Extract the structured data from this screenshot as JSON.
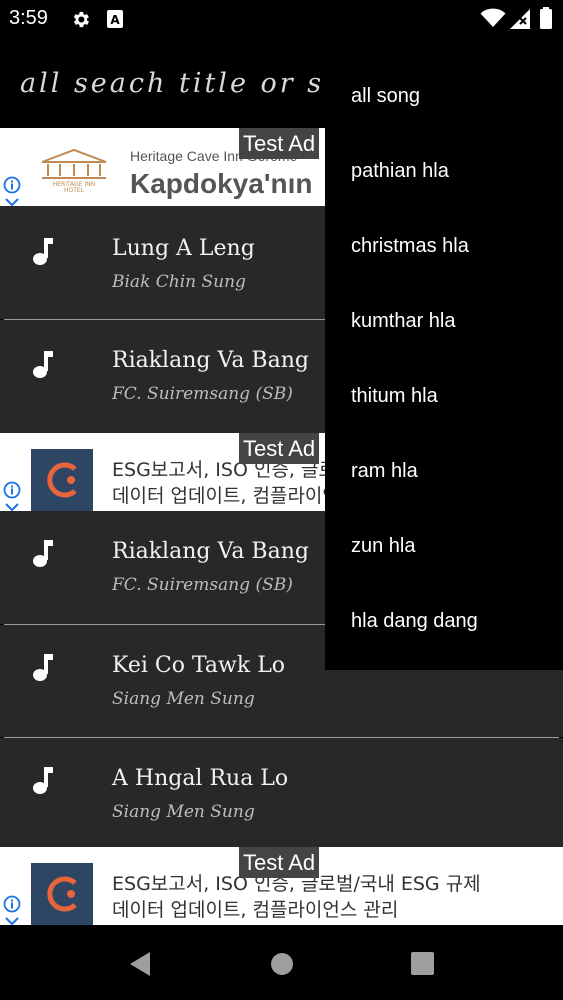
{
  "status_bar": {
    "time": "3:59",
    "icons": [
      "settings-icon",
      "a-icon",
      "wifi-icon",
      "signal-icon",
      "battery-icon"
    ]
  },
  "toolbar": {
    "search_title": "all seach title or sir"
  },
  "ads": [
    {
      "label": "Test Ad",
      "small_text": "Heritage Cave Inn Göreme",
      "big_text": "Kapdokya'nın",
      "logo": "hotel-logo"
    },
    {
      "label": "Test Ad",
      "line1": "ESG보고서, ISO 인증, 글로벌/국내 ESG 규제",
      "line2": "데이터 업데이트, 컴플라이언스 관리",
      "logo": "c-logo"
    },
    {
      "label": "Test Ad",
      "line1": "ESG보고서, ISO 인증, 글로벌/국내 ESG 규제",
      "line2": "데이터 업데이트, 컴플라이언스 관리",
      "logo": "c-logo"
    }
  ],
  "songs": [
    {
      "title": "Lung A Leng",
      "artist": "Biak Chin Sung"
    },
    {
      "title": "Riaklang Va Bang",
      "artist": "FC. Suiremsang (SB)"
    },
    {
      "title": "Riaklang Va Bang",
      "artist": "FC. Suiremsang (SB)"
    },
    {
      "title": "Kei Co Tawk Lo",
      "artist": "Siang Men Sung"
    },
    {
      "title": "A Hngal Rua Lo",
      "artist": "Siang Men Sung"
    }
  ],
  "menu": {
    "items": [
      "all song",
      "pathian hla",
      "christmas hla",
      "kumthar hla",
      "thitum hla",
      "ram hla",
      "zun hla",
      "hla dang dang"
    ]
  },
  "colors": {
    "background": "#000000",
    "list_row": "#282828",
    "menu_bg": "#000000",
    "ad_bg": "#ffffff",
    "info_icon": "#1a73e8",
    "c_logo_bg": "#2d4664",
    "c_logo_accent": "#e8643c"
  }
}
